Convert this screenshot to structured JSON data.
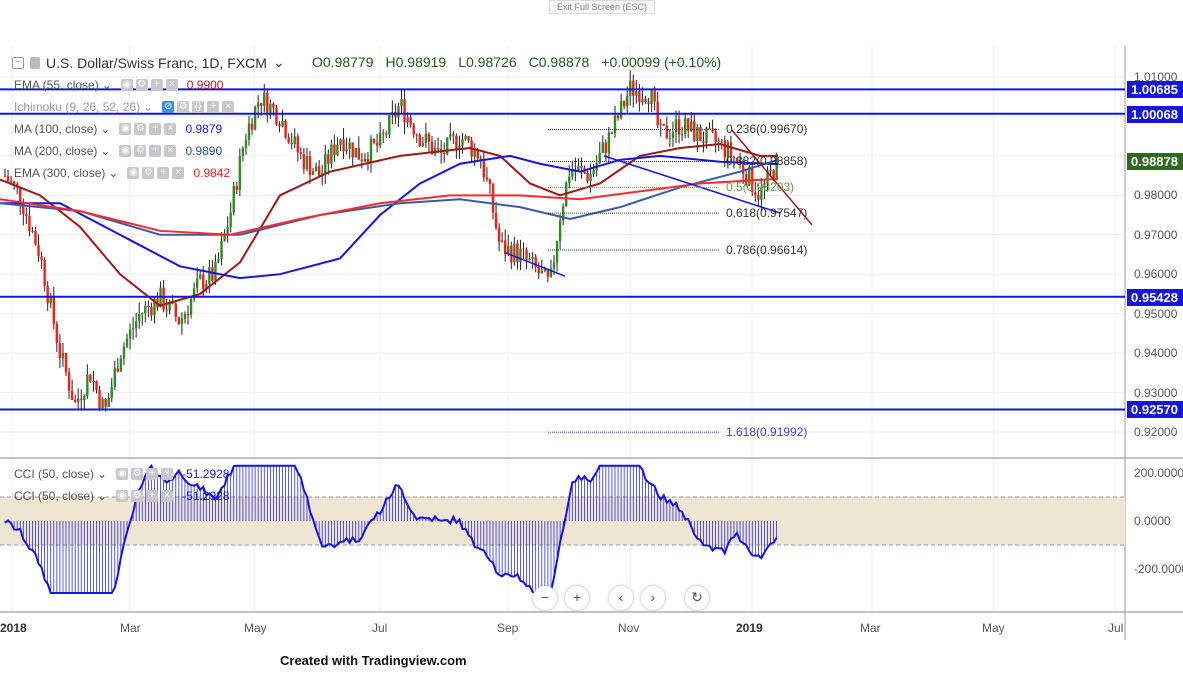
{
  "exit_fullscreen": "Exit Full Screen (ESC)",
  "symbol": {
    "title": "U.S. Dollar/Swiss Franc, 1D, FXCM",
    "open": "O0.98779",
    "high": "H0.98919",
    "low": "L0.98726",
    "close": "C0.98878",
    "change": "+0.00099 (+0.10%)"
  },
  "indicators": [
    {
      "label": "EMA (55, close)",
      "value": "0.9900",
      "color": "#b22222"
    },
    {
      "label": "Ichimoku (9, 26, 52, 26)",
      "value": "",
      "color": "#999"
    },
    {
      "label": "MA (100, close)",
      "value": "0.9879",
      "color": "#1a1adf"
    },
    {
      "label": "MA (200, close)",
      "value": "0.9890",
      "color": "#2a4fa0"
    },
    {
      "label": "EMA (300, close)",
      "value": "0.9842",
      "color": "#ff2020"
    }
  ],
  "cci": [
    {
      "label": "CCI (50, close)",
      "value": "-51.2928"
    },
    {
      "label": "CCI (50, close)",
      "value": "-51.2928"
    }
  ],
  "price_ticks": [
    "1.01000",
    "0.98000",
    "0.97000",
    "0.96000",
    "0.95000",
    "0.94000",
    "0.93000",
    "0.92000"
  ],
  "horizontal_levels": [
    "1.00685",
    "1.00068",
    "0.95428",
    "0.92570"
  ],
  "current_price": "0.98878",
  "fib_levels": [
    "0.236(0.99670)",
    "0.382(0.98858)",
    "0.5(0.98203)",
    "0.618(0.97547)",
    "0.786(0.96614)",
    "1.618(0.91992)"
  ],
  "cci_ticks": [
    "200.0000",
    "0.0000",
    "-200.0000"
  ],
  "time_labels": [
    "2018",
    "Mar",
    "May",
    "Jul",
    "Sep",
    "Nov",
    "2019",
    "Mar",
    "May",
    "Jul"
  ],
  "controls": [
    "−",
    "+",
    "‹",
    "›",
    "↻"
  ],
  "footer": "Created with Tradingview.com"
}
